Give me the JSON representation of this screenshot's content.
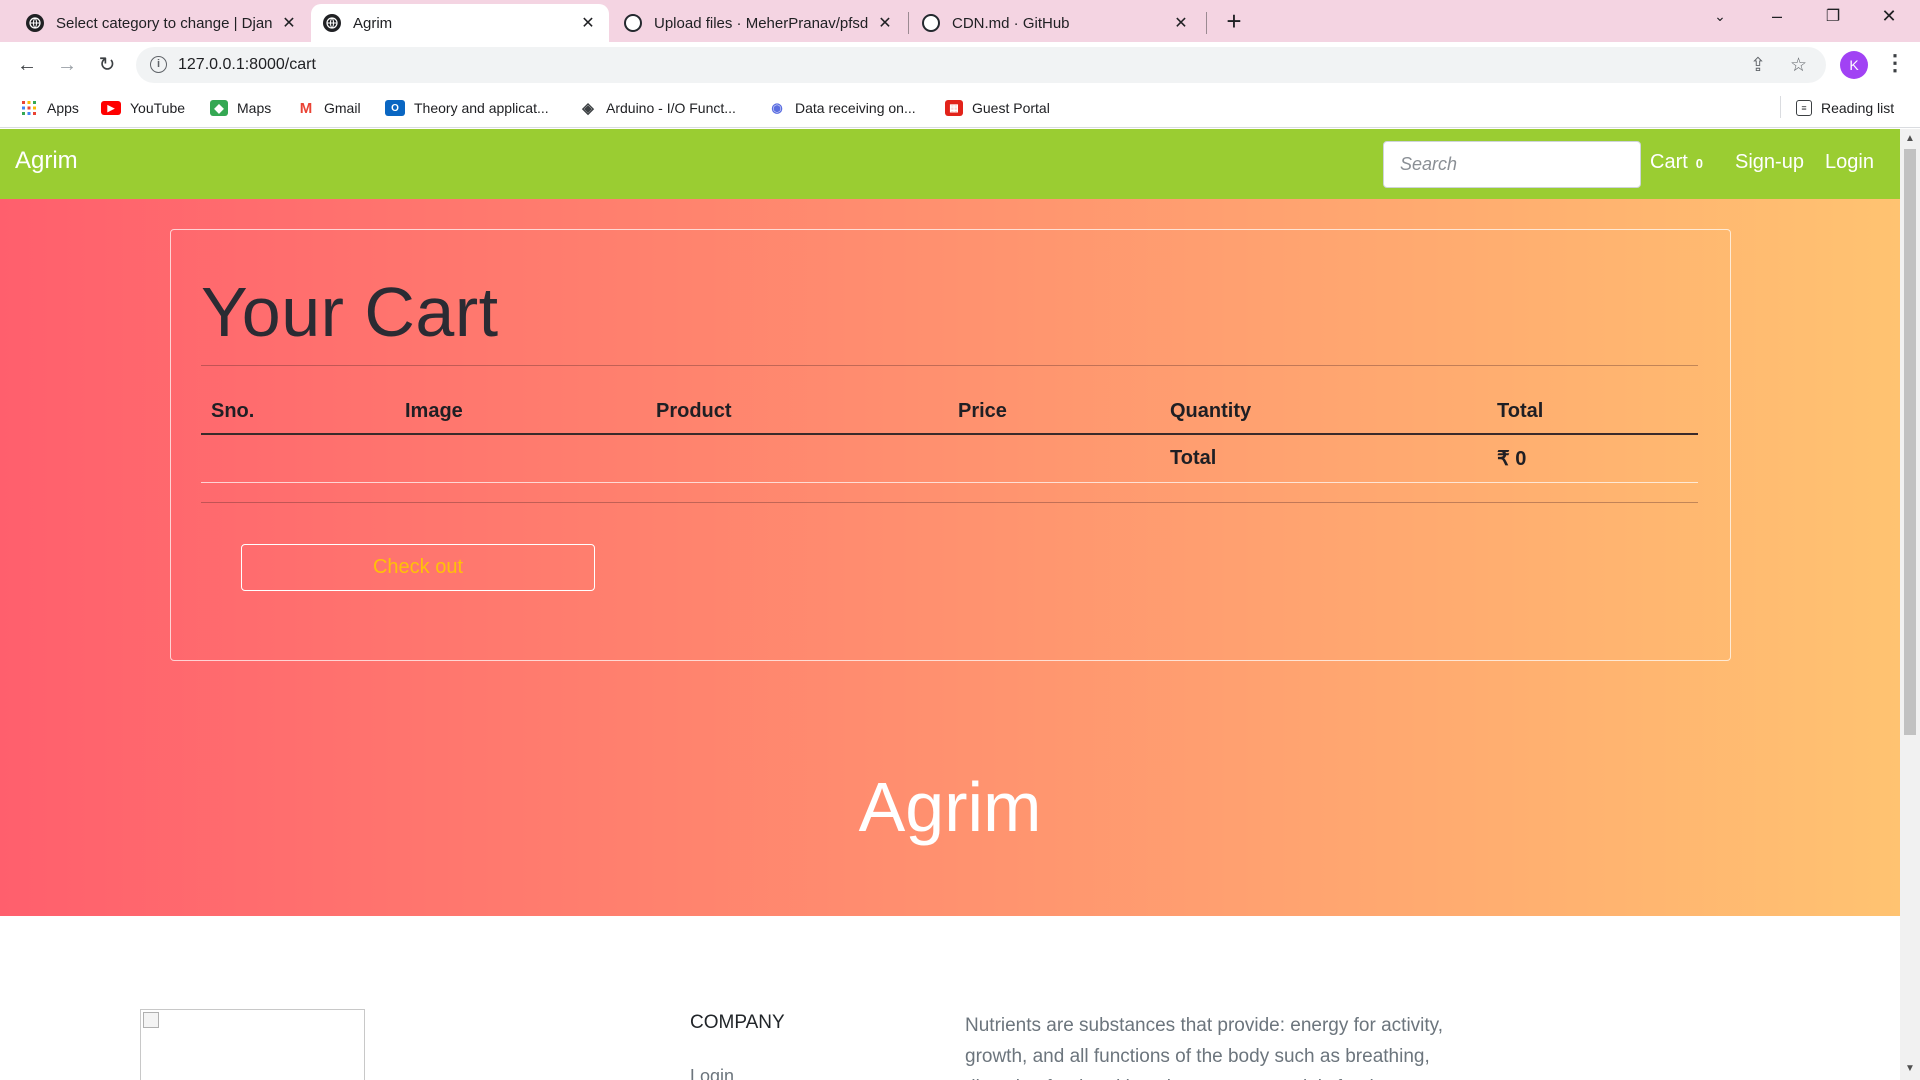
{
  "browser": {
    "tabs": [
      {
        "title": "Select category to change | Djang",
        "icon": "globe-icon"
      },
      {
        "title": "Agrim",
        "icon": "globe-icon"
      },
      {
        "title": "Upload files · MeherPranav/pfsd",
        "icon": "github-icon"
      },
      {
        "title": "CDN.md · GitHub",
        "icon": "github-icon"
      }
    ],
    "url": "127.0.0.1:8000/cart",
    "profile_initial": "K",
    "bookmarks": [
      {
        "label": "Apps",
        "icon": "apps-grid-icon"
      },
      {
        "label": "YouTube",
        "icon": "youtube-icon"
      },
      {
        "label": "Maps",
        "icon": "maps-icon"
      },
      {
        "label": "Gmail",
        "icon": "gmail-icon"
      },
      {
        "label": "Theory and applicat...",
        "icon": "outlook-icon"
      },
      {
        "label": "Arduino - I/O Funct...",
        "icon": "arduino-icon"
      },
      {
        "label": "Data receiving on...",
        "icon": "camera-icon"
      },
      {
        "label": "Guest Portal",
        "icon": "fortinet-icon"
      }
    ],
    "reading_list": "Reading list"
  },
  "site": {
    "brand": "Agrim",
    "search_placeholder": "Search",
    "nav": {
      "cart": "Cart",
      "cart_count": "0",
      "signup": "Sign-up",
      "login": "Login"
    },
    "accent_color": "#9acd32",
    "gradient": [
      "#ff5f6d",
      "#ffc371"
    ]
  },
  "cart": {
    "title": "Your Cart",
    "columns": [
      "Sno.",
      "Image",
      "Product",
      "Price",
      "Quantity",
      "Total"
    ],
    "total_label": "Total",
    "total_value": "₹ 0",
    "checkout_label": "Check out",
    "checkout_color": "#ffc107"
  },
  "hero_brand": "Agrim",
  "footer": {
    "company_heading": "COMPANY",
    "company_link": "Login",
    "description": "Nutrients are substances that provide: energy for activity, growth, and all functions of the body such as breathing, digesting food and keeping warm; materials for the"
  }
}
